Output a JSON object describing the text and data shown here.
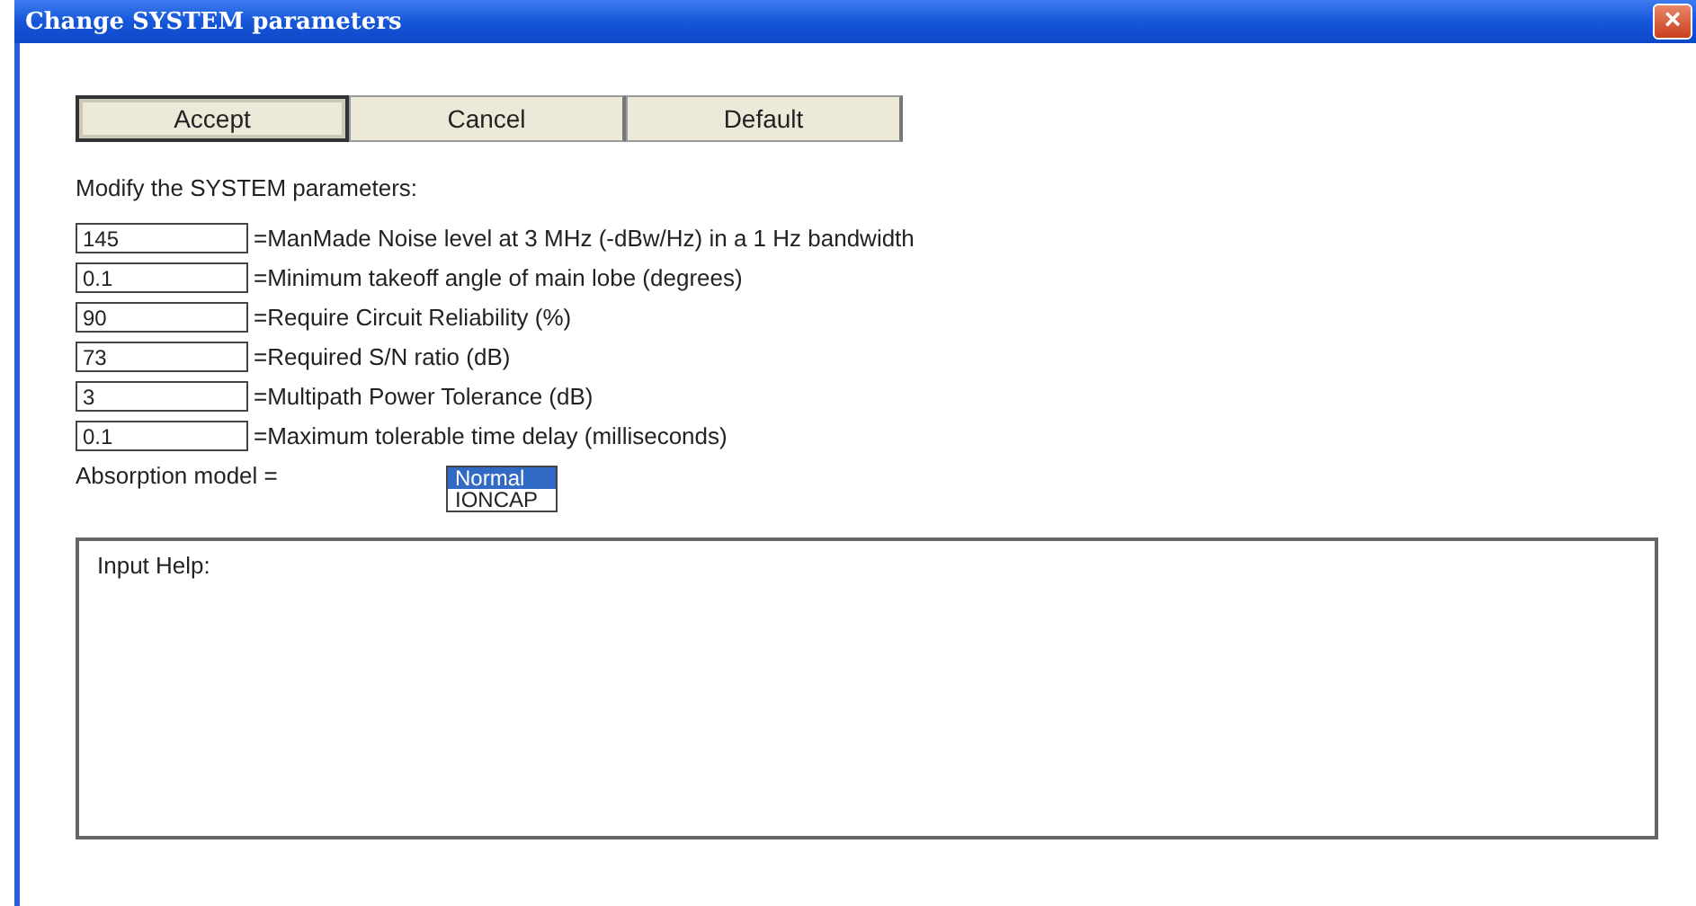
{
  "window": {
    "title": "Change SYSTEM parameters",
    "close": "×"
  },
  "buttons": [
    {
      "label": "Accept",
      "focused": true
    },
    {
      "label": "Cancel",
      "focused": false
    },
    {
      "label": "Default",
      "focused": false
    }
  ],
  "intro": "Modify the SYSTEM parameters:",
  "parameters": [
    {
      "value": "145",
      "label": "=ManMade Noise level at 3 MHz (-dBw/Hz) in a 1 Hz bandwidth"
    },
    {
      "value": "0.1",
      "label": "=Minimum takeoff angle of main lobe (degrees)"
    },
    {
      "value": "90",
      "label": "=Require Circuit Reliability (%)"
    },
    {
      "value": "73",
      "label": "=Required S/N ratio (dB)"
    },
    {
      "value": "3",
      "label": "=Multipath Power Tolerance (dB)"
    },
    {
      "value": "0.1",
      "label": "=Maximum tolerable time delay (milliseconds)"
    }
  ],
  "absorption": {
    "label": "Absorption model =",
    "options": [
      {
        "label": "Normal",
        "selected": true
      },
      {
        "label": "IONCAP",
        "selected": false
      }
    ]
  },
  "help": {
    "title": "Input Help:"
  }
}
